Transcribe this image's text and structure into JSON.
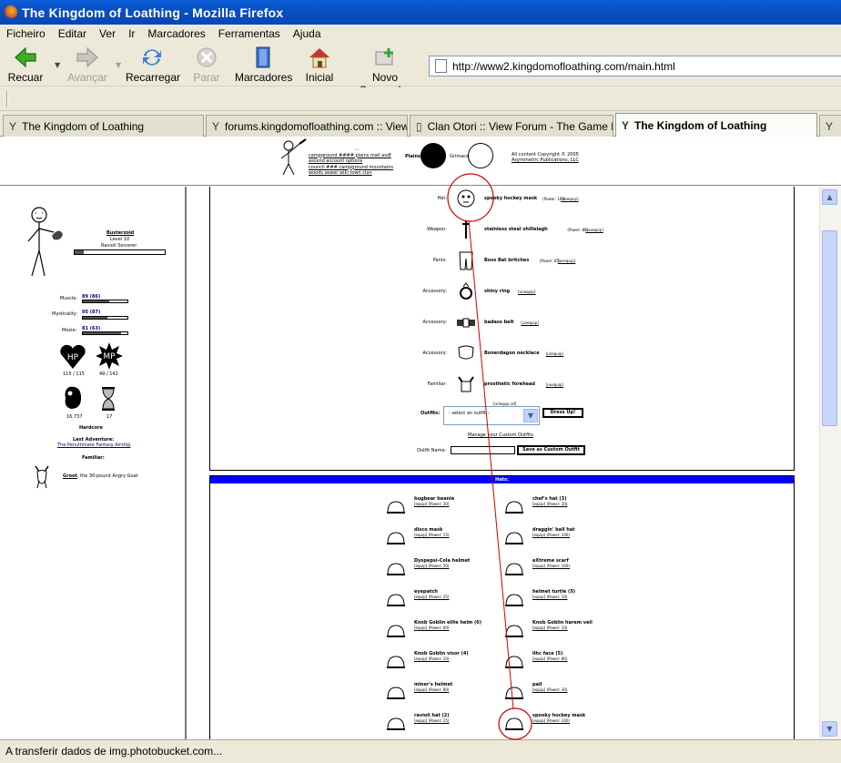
{
  "window": {
    "title": "The Kingdom of Loathing - Mozilla Firefox"
  },
  "menu": [
    "Ficheiro",
    "Editar",
    "Ver",
    "Ir",
    "Marcadores",
    "Ferramentas",
    "Ajuda"
  ],
  "toolbar": {
    "back": "Recuar",
    "forward": "Avançar",
    "reload": "Recarregar",
    "stop": "Parar",
    "bookmarks": "Marcadores",
    "home": "Inicial",
    "new_tab": "Novo Separador"
  },
  "url": "http://www2.kingdomofloathing.com/main.html",
  "tabs": [
    {
      "label": "The Kingdom of Loathing",
      "active": false
    },
    {
      "label": "forums.kingdomofloathing.com :: View...",
      "active": false
    },
    {
      "label": "Clan Otori :: View Forum - The Game B...",
      "active": false
    },
    {
      "label": "The Kingdom of Loathing",
      "active": true
    }
  ],
  "topmenu": {
    "links_row1": "campground  ####  plains  mall  asdf  ascend  account  options",
    "links_row2": "council  ###  campground  mountains  woods  sewer  wiki  town  clan",
    "links_row3": "...",
    "seal_label": "Plains",
    "moon_label": "Grimace",
    "copyright": "All content Copyright © 2005",
    "copyright2": "Asymmetric Publications, LLC"
  },
  "character": {
    "name": "Busterzoid",
    "level": "Level 10",
    "class": "Ravioli Sorcerer",
    "muscle_label": "Muscle:",
    "muscle": "89 (86)",
    "mysticality_label": "Mysticality:",
    "mysticality": "95 (87)",
    "moxie_label": "Moxie:",
    "moxie": "81 (63)",
    "hp": "115 / 115",
    "mp": "49 / 142",
    "hp_icon": "HP",
    "mp_icon": "MP",
    "meat": "16,737",
    "adventures": "17",
    "mode": "Hardcore",
    "last_adventure_label": "Last Adventure:",
    "last_adventure": "The Penultimate Fantasy Airship",
    "familiar_label": "Familiar:",
    "familiar_name": "Groot",
    "familiar_desc": ", the 30-pound Angry Goat",
    "level_progress": 0.1,
    "muscle_progress": 0.6,
    "mysticality_progress": 0.55,
    "moxie_progress": 0.85
  },
  "equipment": [
    {
      "slot": "Hat:",
      "item": "spooky hockey mask",
      "power": "(Power: 100)",
      "action": "[unequip]"
    },
    {
      "slot": "Weapon:",
      "item": "stainless steel shillelagh",
      "power": "(Power: 80)",
      "action": "[unequip]"
    },
    {
      "slot": "Pants:",
      "item": "Boss Bat britches",
      "power": "(Power: 85)",
      "action": "[unequip]"
    },
    {
      "slot": "Accessory:",
      "item": "shiny ring",
      "power": "",
      "action": "[unequip]"
    },
    {
      "slot": "Accessory:",
      "item": "badass belt",
      "power": "",
      "action": "[unequip]"
    },
    {
      "slot": "Accessory:",
      "item": "Bonerdagon necklace",
      "power": "",
      "action": "[unequip]"
    },
    {
      "slot": "Familiar:",
      "item": "prosthetic forehead",
      "power": "",
      "action": "[unequip]"
    }
  ],
  "unequip_all": "[unequip all]",
  "outfits": {
    "label": "Outfits:",
    "selected": "- select an outfit -",
    "dress_button": "Dress Up!",
    "manage": "Manage your Custom Outfits",
    "name_label": "Outfit Name:",
    "save_button": "Save as Custom Outfit"
  },
  "hats": {
    "header": "Hats:",
    "left": [
      {
        "name": "bugbear beanie",
        "power": "[equip]  (Power: 30)"
      },
      {
        "name": "disco mask",
        "power": "[equip]  (Power: 15)"
      },
      {
        "name": "Dyspepsi-Cola helmet",
        "power": "[equip]  (Power: 50)"
      },
      {
        "name": "eyepatch",
        "power": "[equip]  (Power: 25)"
      },
      {
        "name": "Knob Goblin elite helm (6)",
        "power": "[equip]  (Power: 60)"
      },
      {
        "name": "Knob Goblin visor (4)",
        "power": "[equip]  (Power: 10)"
      },
      {
        "name": "miner's helmet",
        "power": "[equip]  (Power: 80)"
      },
      {
        "name": "ravioli hat (2)",
        "power": "[equip]  (Power: 15)"
      }
    ],
    "right": [
      {
        "name": "chef's hat (3)",
        "power": "[equip]  (Power: 30)"
      },
      {
        "name": "draggin' ball hat",
        "power": "[equip]  (Power: 100)"
      },
      {
        "name": "eXtreme scarf",
        "power": "[equip]  (Power: 100)"
      },
      {
        "name": "helmet turtle (5)",
        "power": "[equip]  (Power: 10)"
      },
      {
        "name": "Knob Goblin harem veil",
        "power": "[equip]  (Power: 10)"
      },
      {
        "name": "lihc face (5)",
        "power": "[equip]  (Power: 80)"
      },
      {
        "name": "pail",
        "power": "[equip]  (Power: 30)"
      },
      {
        "name": "spooky hockey mask",
        "power": "[equip]  (Power: 100)"
      }
    ]
  },
  "status": "A transferir dados de img.photobucket.com...",
  "colors": {
    "titlebar": "#0a4fc2",
    "hats_header": "#0000ff",
    "annotation": "#cc0000"
  }
}
